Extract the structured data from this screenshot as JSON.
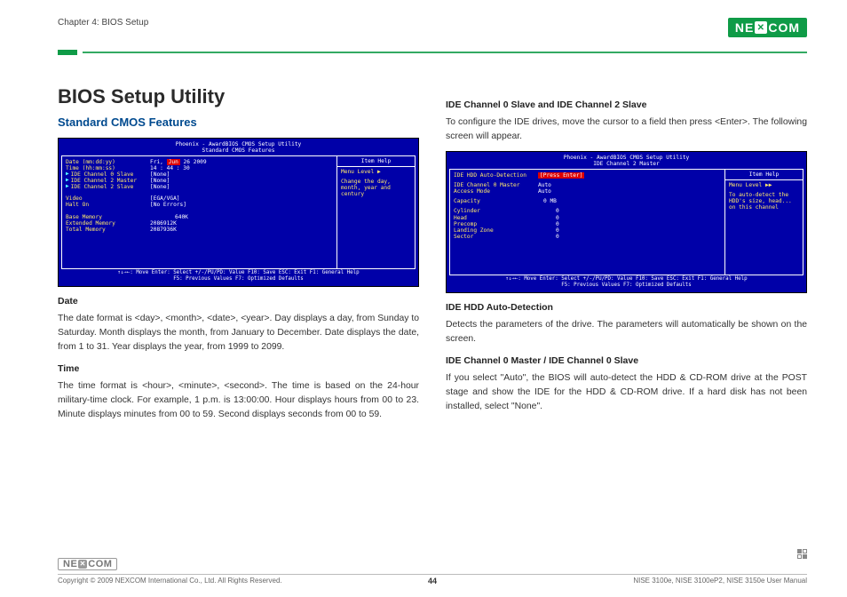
{
  "meta": {
    "chapter_label": "Chapter 4: BIOS Setup",
    "brand_name": "NEXCOM",
    "page_number": "44",
    "copyright": "Copyright © 2009 NEXCOM International Co., Ltd. All Rights Reserved.",
    "footer_right": "NISE 3100e, NISE 3100eP2, NISE 3150e User Manual"
  },
  "left": {
    "h1": "BIOS Setup Utility",
    "h2": "Standard CMOS Features",
    "bios1": {
      "header_line1": "Phoenix - AwardBIOS CMOS Setup Utility",
      "header_line2": "Standard CMOS Features",
      "date_label": "Date (mm:dd:yy)",
      "date_value_pre": "Fri, ",
      "date_value_red": "Jun",
      "date_value_post": " 26 2009",
      "time_label": "Time (hh:mm:ss)",
      "time_value": "14 : 44 : 30",
      "slave0_label": "IDE Channel 0 Slave",
      "slave0_val": "[None]",
      "master2_label": "IDE Channel 2 Master",
      "master2_val": "[None]",
      "slave2_label": "IDE Channel 2 Slave",
      "slave2_val": "[None]",
      "video_label": "Video",
      "video_val": "[EGA/VGA]",
      "halton_label": "Halt On",
      "halton_val": "[No Errors]",
      "basemem_label": "Base Memory",
      "basemem_val": "640K",
      "extmem_label": "Extended Memory",
      "extmem_val": "2086912K",
      "totmem_label": "Total Memory",
      "totmem_val": "2087936K",
      "right_header": "Item Help",
      "right_level": "Menu Level      ▶",
      "right_help": "Change the day, month, year and century",
      "footer1": "↑↓→←: Move        Enter: Select      +/-/PU/PD: Value          F10: Save       ESC: Exit       F1: General Help",
      "footer2": "F5: Previous Values                               F7: Optimized Defaults"
    },
    "date_head": "Date",
    "date_body": "The date format is <day>, <month>, <date>, <year>. Day displays a day, from Sunday to Saturday. Month displays the month, from January to December. Date displays the date, from 1 to 31. Year displays the year, from 1999 to 2099.",
    "time_head": "Time",
    "time_body": "The time format is <hour>, <minute>, <second>. The time is based on the 24-hour military-time clock. For example, 1 p.m. is 13:00:00. Hour displays hours from 00 to 23. Minute displays minutes from 00 to 59. Second displays seconds from 00 to 59."
  },
  "right": {
    "h3a": "IDE Channel 0 Slave and IDE Channel 2 Slave",
    "p1": "To configure the IDE drives, move the cursor to a field then press <Enter>. The following screen will appear.",
    "bios2": {
      "header_line1": "Phoenix - AwardBIOS CMOS Setup Utility",
      "header_line2": "IDE Channel 2 Master",
      "auto_label": "IDE HDD Auto-Detection",
      "auto_val": "[Press Enter]",
      "ch0m_label": "IDE Channel 0 Master",
      "ch0m_val": "Auto",
      "access_label": "Access Mode",
      "access_val": "Auto",
      "cap_label": "Capacity",
      "cap_val": "0 MB",
      "cyl_label": "Cylinder",
      "cyl_val": "0",
      "head_label": "Head",
      "head_val": "0",
      "pre_label": "Precomp",
      "pre_val": "0",
      "lz_label": "Landing Zone",
      "lz_val": "0",
      "sec_label": "Sector",
      "sec_val": "0",
      "right_header": "Item Help",
      "right_level": "Menu Level    ▶▶",
      "right_help": "To auto-detect the HDD's size, head... on this channel",
      "footer1": "↑↓→←: Move        Enter: Select      +/-/PU/PD: Value          F10: Save       ESC: Exit       F1: General Help",
      "footer2": "F5: Previous Values                               F7: Optimized Defaults"
    },
    "h3b": "IDE HDD Auto-Detection",
    "p2": "Detects the parameters of the drive. The parameters will automatically be shown on the screen.",
    "h3c": "IDE Channel 0 Master / IDE Channel 0 Slave",
    "p3": "If you select \"Auto\", the BIOS will auto-detect the HDD & CD-ROM drive at the POST stage and show the IDE for the HDD & CD-ROM drive. If a hard disk has not been installed, select \"None\"."
  }
}
